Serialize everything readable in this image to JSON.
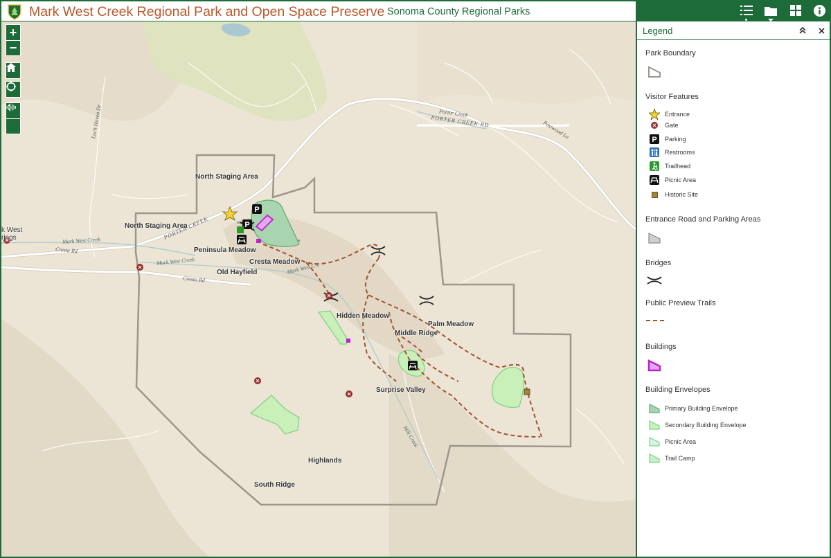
{
  "header": {
    "title": "Mark West Creek Regional Park and Open Space Preserve",
    "subtitle": "Sonoma County Regional Parks",
    "tools": [
      "layer-list-icon",
      "folder-icon",
      "grid-icon",
      "info-icon"
    ]
  },
  "map_controls": {
    "zoom_in": "+",
    "zoom_out": "−"
  },
  "map_labels": {
    "areas": [
      "North Staging Area",
      "North Staging Area",
      "Peninsula Meadow",
      "Cresta Meadow",
      "Old Hayfield",
      "Hidden Meadow",
      "Palm Meadow",
      "Middle Ridge",
      "Surprise Valley",
      "Highlands",
      "South Ridge"
    ],
    "roads": [
      "Porter Creek",
      "PORTER CREEK RD",
      "Postwood Ln",
      "Loch Haven Dr",
      "Cresta Rd",
      "Cresta Rd",
      "PORTER CREEK"
    ],
    "creeks": [
      "Mark West Creek",
      "Mark West Creek",
      "Mark West Cre",
      "Mill Creek"
    ],
    "edge_text": [
      "k West",
      "rings"
    ]
  },
  "legend": {
    "title": "Legend",
    "sections": [
      {
        "title": "Park Boundary",
        "items": []
      },
      {
        "title": "Visitor Features",
        "items": [
          "Entrance",
          "Gate",
          "Parking",
          "Restrooms",
          "Trailhead",
          "Picnic Area",
          "Historic Site"
        ]
      },
      {
        "title": "Entrance Road and Parking Areas",
        "items": []
      },
      {
        "title": "Bridges",
        "items": []
      },
      {
        "title": "Public Preview Trails",
        "items": []
      },
      {
        "title": "Buildings",
        "items": []
      },
      {
        "title": "Building Envelopes",
        "items": [
          "Primary Building Envelope",
          "Secondary Building Envelope",
          "Picnic Area",
          "Trail Camp"
        ]
      }
    ],
    "parking_glyph": "P"
  },
  "colors": {
    "brand_green": "#1e6b3a",
    "title_orange": "#b8582a",
    "trail": "#a0522d",
    "boundary": "#9b978e",
    "building": "#c020d0",
    "envelope_primary": "#a8d4b0",
    "envelope_secondary": "#c8f0b8"
  }
}
